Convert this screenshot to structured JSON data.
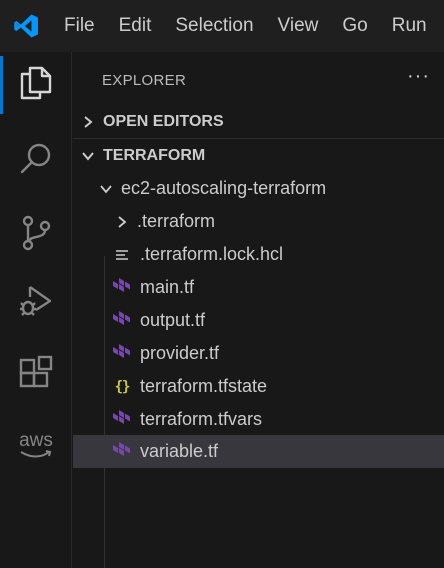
{
  "titlebar": {
    "menu": [
      "File",
      "Edit",
      "Selection",
      "View",
      "Go",
      "Run"
    ]
  },
  "activity_bar": {
    "items": [
      {
        "icon": "files-icon",
        "active": true
      },
      {
        "icon": "search-icon",
        "active": false
      },
      {
        "icon": "source-control-icon",
        "active": false
      },
      {
        "icon": "run-debug-icon",
        "active": false
      },
      {
        "icon": "extensions-icon",
        "active": false
      },
      {
        "icon": "aws-icon",
        "label": "aws",
        "active": false
      }
    ]
  },
  "explorer": {
    "title": "EXPLORER",
    "more": "···",
    "sections": {
      "open_editors": "OPEN EDITORS",
      "workspace": "TERRAFORM"
    },
    "folder": "ec2-autoscaling-terraform",
    "files": [
      {
        "label": ".terraform",
        "type": "folder"
      },
      {
        "label": ".terraform.lock.hcl",
        "type": "lock"
      },
      {
        "label": "main.tf",
        "type": "terraform"
      },
      {
        "label": "output.tf",
        "type": "terraform"
      },
      {
        "label": "provider.tf",
        "type": "terraform"
      },
      {
        "label": "terraform.tfstate",
        "type": "json"
      },
      {
        "label": "terraform.tfvars",
        "type": "terraform"
      },
      {
        "label": "variable.tf",
        "type": "terraform",
        "selected": true
      }
    ]
  },
  "colors": {
    "accent": "#0078d4",
    "terraform_purple": "#7b42bc",
    "json_yellow": "#cbcb41",
    "selection": "#37373d"
  }
}
